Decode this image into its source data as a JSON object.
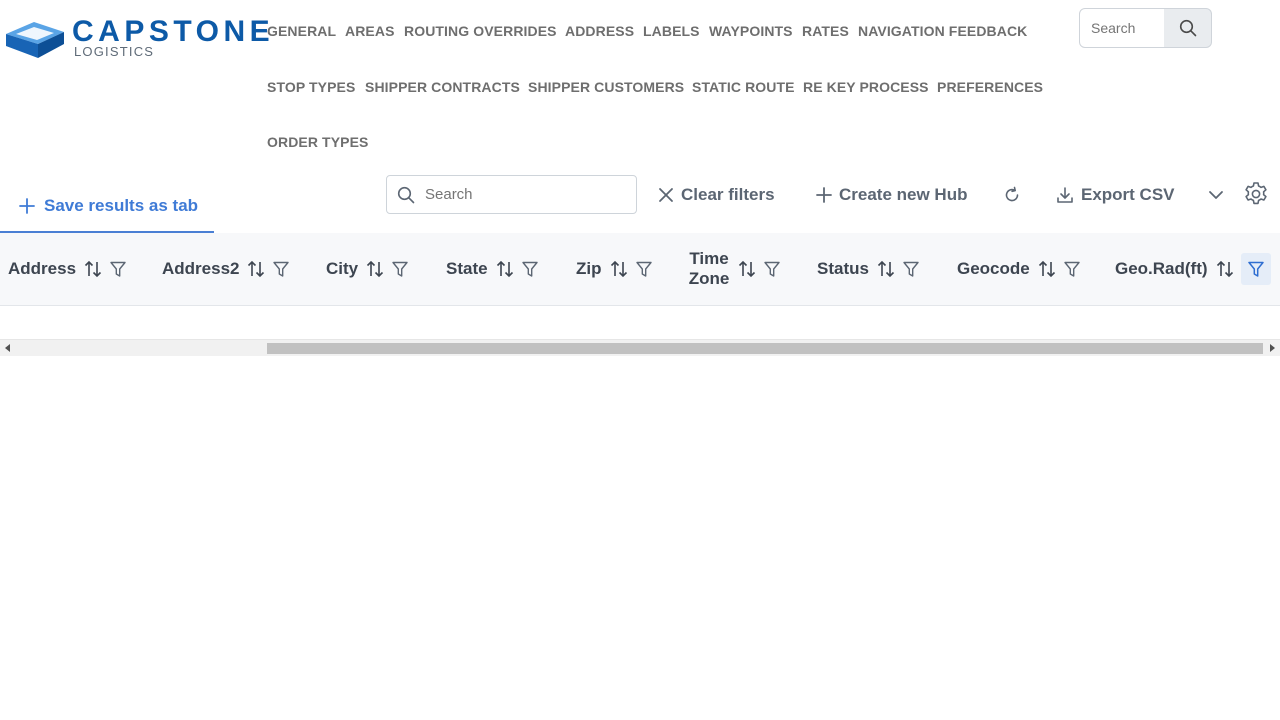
{
  "brand": {
    "name": "CAPSTONE",
    "tagline": "LOGISTICS",
    "color": "#0d5aa7"
  },
  "nav": {
    "items": [
      "GENERAL",
      "AREAS",
      "ROUTING OVERRIDES",
      "ADDRESS",
      "LABELS",
      "WAYPOINTS",
      "RATES",
      "NAVIGATION FEEDBACK",
      "STOP TYPES",
      "SHIPPER CONTRACTS",
      "SHIPPER CUSTOMERS",
      "STATIC ROUTE",
      "RE KEY PROCESS",
      "PREFERENCES",
      "ORDER TYPES"
    ]
  },
  "header_search": {
    "placeholder": "Search",
    "icon": "search-icon"
  },
  "toolbar": {
    "save_tab_label": "Save results as tab",
    "search_placeholder": "Search",
    "clear_filters_label": "Clear filters",
    "create_label": "Create new Hub",
    "export_label": "Export CSV",
    "accent": "#3f7bd6"
  },
  "grid": {
    "columns": [
      {
        "label": "Address",
        "filter_active": false
      },
      {
        "label": "Address2",
        "filter_active": false
      },
      {
        "label": "City",
        "filter_active": false
      },
      {
        "label": "State",
        "filter_active": false
      },
      {
        "label": "Zip",
        "filter_active": false
      },
      {
        "label": "Time Zone",
        "filter_active": false
      },
      {
        "label": "Status",
        "filter_active": false
      },
      {
        "label": "Geocode",
        "filter_active": false
      },
      {
        "label": "Geo.Rad(ft)",
        "filter_active": true
      }
    ],
    "rows": []
  }
}
